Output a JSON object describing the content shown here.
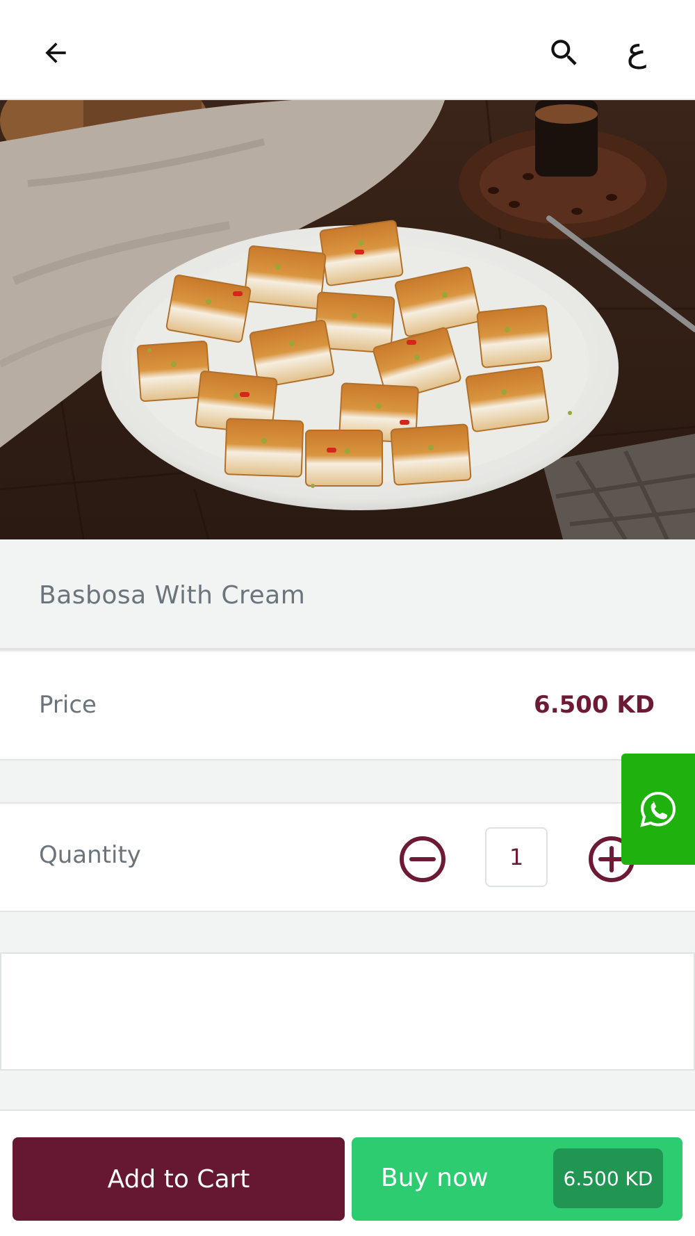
{
  "header": {
    "back_icon": "arrow-left-icon",
    "search_icon": "search-icon",
    "language_toggle": "ع"
  },
  "product": {
    "image_alt": "plate of basbosa squares topped with pistachio",
    "title": "Basbosa With Cream"
  },
  "price_row": {
    "label": "Price",
    "value": "6.500 KD"
  },
  "quantity_row": {
    "label": "Quantity",
    "value": "1",
    "minus_icon": "minus-circle-icon",
    "plus_icon": "plus-circle-icon"
  },
  "whatsapp": {
    "icon": "whatsapp-icon"
  },
  "actions": {
    "add_to_cart": "Add to Cart",
    "buy_now": "Buy now",
    "buy_now_price": "6.500 KD"
  },
  "colors": {
    "brand": "#661833",
    "price_text": "#6d1a36",
    "buy_green": "#2ecc71",
    "buy_price_green": "#219653",
    "whatsapp_green": "#1fb20f"
  }
}
